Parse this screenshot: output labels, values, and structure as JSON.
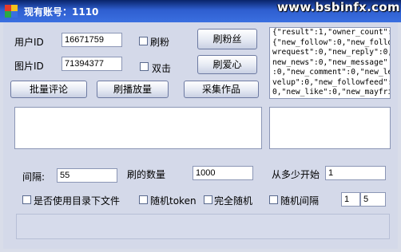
{
  "window": {
    "title": "现有账号：1110",
    "watermark": "www.bsbinfx.com"
  },
  "fields": {
    "user_id_label": "用户ID",
    "user_id_value": "16671759",
    "image_id_label": "图片ID",
    "image_id_value": "71394377"
  },
  "checks": {
    "brush_fans": "刷粉",
    "double_click": "双击",
    "use_subdir": "是否使用目录下文件",
    "random_token": "随机token",
    "full_random": "完全随机",
    "random_interval": "随机间隔"
  },
  "buttons": {
    "brush_fans": "刷粉丝",
    "brush_love": "刷爱心",
    "batch_comment": "批量评论",
    "brush_plays": "刷播放量",
    "collect_works": "采集作品"
  },
  "response_lines": [
    "{\"result\":1,\"owner_count\":",
    "{\"new_follow\":0,\"new_follo",
    "wrequest\":0,\"new_reply\":0,\"",
    "new_news\":0,\"new_message\"",
    ":0,\"new_comment\":0,\"new_le",
    "velup\":0,\"new_followfeed\":",
    "0,\"new_like\":0,\"new_mayfri"
  ],
  "settings": {
    "interval_label": "间隔:",
    "interval_value": "55",
    "brush_count_label": "刷的数量",
    "brush_count_value": "1000",
    "start_from_label": "从多少开始",
    "start_from_value": "1",
    "random_min": "1",
    "random_max": "5"
  }
}
